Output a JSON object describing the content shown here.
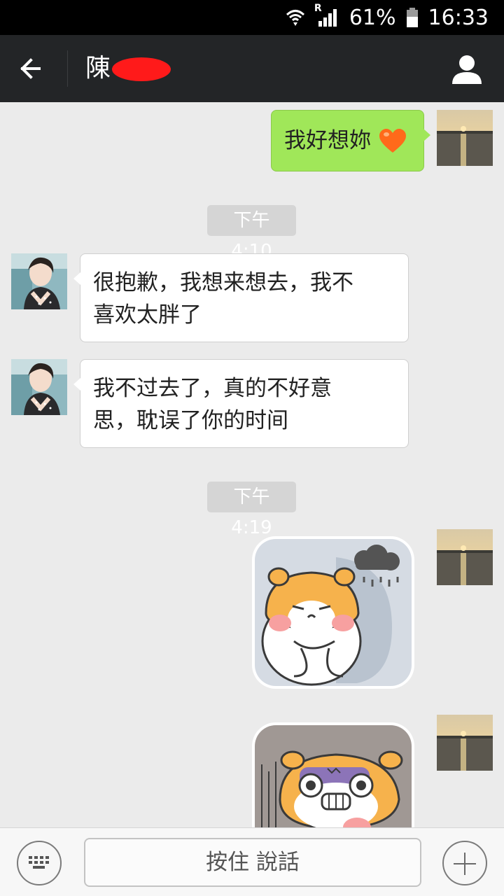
{
  "status_bar": {
    "battery": "61%",
    "time": "16:33",
    "roaming_indicator": "R"
  },
  "header": {
    "contact_name": "陳"
  },
  "messages": [
    {
      "type": "text",
      "side": "sent",
      "text": "我好想妳",
      "emoji": "orange-heart"
    },
    {
      "type": "timestamp",
      "text": "下午4:10"
    },
    {
      "type": "text",
      "side": "received",
      "lines": [
        "很抱歉，我想来想去，我不",
        "喜欢太胖了"
      ]
    },
    {
      "type": "text",
      "side": "received",
      "lines": [
        "我不过去了，真的不好意",
        "思，耽误了你的时间"
      ]
    },
    {
      "type": "timestamp",
      "text": "下午4:19"
    },
    {
      "type": "sticker",
      "side": "sent",
      "sticker": "sad-hamster-rain-cloud"
    },
    {
      "type": "sticker",
      "side": "sent",
      "sticker": "crying-hamster"
    }
  ],
  "input_bar": {
    "hold_to_talk_label": "按住 說話"
  },
  "colors": {
    "sent_bubble": "#a0e759",
    "header_bg": "#232527",
    "chat_bg": "#ebebeb"
  }
}
